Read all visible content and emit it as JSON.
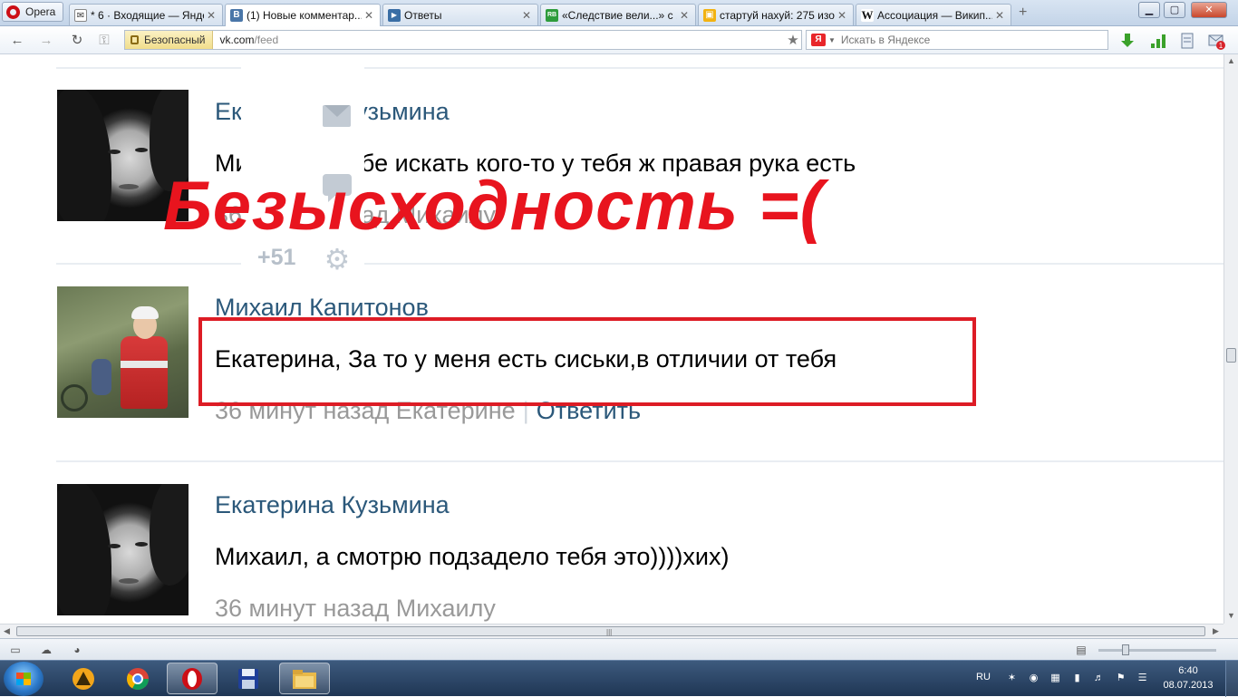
{
  "browser": {
    "menu_label": "Opera",
    "tabs": [
      {
        "title": "* 6 · Входящие — Янде...",
        "fav_color": "#ffffff",
        "fav_text": "✉",
        "active": false
      },
      {
        "title": "(1) Новые комментар...",
        "fav_color": "#4a76a8",
        "fav_text": "B",
        "active": true
      },
      {
        "title": "Ответы",
        "fav_color": "#3a6ea5",
        "fav_text": "▶",
        "active": false
      },
      {
        "title": "«Следствие вели...» с ...",
        "fav_color": "#2e9c3c",
        "fav_text": "RB",
        "active": false
      },
      {
        "title": "стартуй нахуй: 275 изо...",
        "fav_color": "#f2b211",
        "fav_text": "▣",
        "active": false
      },
      {
        "title": "Ассоциация — Викип...",
        "fav_color": "#ffffff",
        "fav_text": "W",
        "active": false
      }
    ],
    "close_glyph": "✕",
    "new_tab_glyph": "+",
    "window_controls": {
      "minimize": "▁",
      "maximize": "▢",
      "close": "✕"
    },
    "security_label": "Безопасный",
    "url_host": "vk.com",
    "url_path": "/feed",
    "search_placeholder": "Искать в Яндексе",
    "yandex_badge": "Я",
    "download_badge": "1"
  },
  "feed": {
    "posts": [
      {
        "author": "Екатерина Кузьмина",
        "text": "Михаил, а тебе искать кого-то у тебя ж правая рука есть",
        "meta_time": "36 минут назад Михаилу"
      },
      {
        "author": "Михаил Капитонов",
        "text": "Екатерина, За то у меня есть сиськи,в отличии от тебя",
        "meta_time": "36 минут назад Екатерине",
        "meta_sep": "|",
        "reply_label": "Ответить"
      },
      {
        "author": "Екатерина Кузьмина",
        "text": "Михаил, а смотрю подзадело тебя это))))хих)",
        "meta_time": "36 минут назад Михаилу"
      }
    ],
    "side_panel": {
      "counter": "+51"
    },
    "overlay_caption": "Безысходность =(",
    "overlay_color": "#e8141e"
  },
  "taskbar": {
    "lang": "RU",
    "time": "6:40",
    "date": "08.07.2013"
  }
}
